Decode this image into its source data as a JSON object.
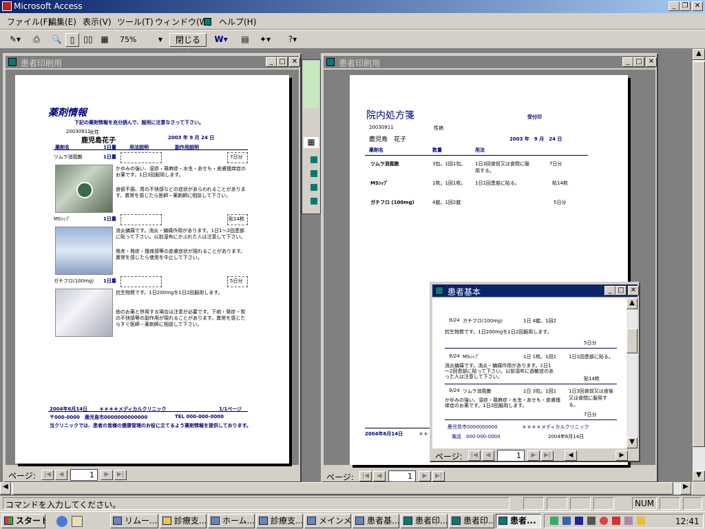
{
  "app": {
    "title": "Microsoft Access"
  },
  "menu": [
    "ファイル(F)",
    "編集(E)",
    "表示(V)",
    "ツール(T)",
    "ウィンドウ(W)",
    "ヘルプ(H)"
  ],
  "toolbar": {
    "zoom": "75%",
    "close_label": "閉じる(C)"
  },
  "win1": {
    "title": "患者印刷用",
    "page_label": "ページ:",
    "page_value": "1",
    "doc": {
      "title": "薬剤情報",
      "subtitle": "下記の薬剤情報を充分読んで、服用に注意なさって下さい。",
      "patient_id": "20030911",
      "sex": "女性",
      "patient_name": "鹿児島花子",
      "date": "2003 年 9 月 24 日",
      "headers": [
        "薬剤名",
        "1日量",
        "用法説明",
        "副作用説明"
      ],
      "drug1": "ツムラ消風散",
      "drug2": "MSｼｯﾌﾟ",
      "drug3": "ガチフロ(100mg)",
      "dose": "1日量",
      "days1": "7日分",
      "days2": "貼14枚",
      "days3": "5日分",
      "effect1": "かゆみの強い、湿疹・蕁麻疹・水虫・あせも・皮膚掻痒症のお薬です。1日3回服用します。",
      "side1": "食欲不振、胃の不快感などの症状があらわれることがあります。異常を感じたら医師・薬剤師に相談して下さい。",
      "effect2": "消炎鎮痛です。消炎・鎮痛作用があります。1日1～2回患部に貼って下さい。以前湿布にかぶれた人は注意して下さい。",
      "side2": "発赤・発疹・掻痒感等の皮膚症状が現れることがあります。異常を感じたら使用を中止して下さい。",
      "effect3": "抗生物質です。1日200mgを1日2回服用します。",
      "side3": "他のお薬と併用する場合は注意が必要です。下痢・発疹・胃の不快感等の副作用が現れることがあります。異常を感じたらすぐ医師・薬剤師に相談して下さい。",
      "footer_date": "2004年6月14日",
      "clinic": "＊＊＊＊メディカルクリニック",
      "pageno": "1/1ページ",
      "address": "〒000-0000　鹿児島市0000000000000",
      "tel": "TEL 000-000-0000",
      "note": "当クリニックでは、患者の皆様の健康管理のお役に立てるよう薬剤情報を提供しております。"
    }
  },
  "win2": {
    "title": "患者印刷用",
    "page_label": "ページ:",
    "page_value": "1",
    "doc": {
      "title": "院内処方箋",
      "stamp": "受付印",
      "patient_id": "20030911",
      "sex": "性病",
      "patient_name": "鹿児島　花子",
      "date": "2003 年　9 月　24 日",
      "headers": [
        "薬剤名",
        "数量",
        "用法"
      ],
      "rows": [
        {
          "name": "ツムラ消風散",
          "qty": "3包。1回1包。",
          "usage": "1日3回食前又は食間に服用する。",
          "days": "7日分"
        },
        {
          "name": "MSｼｯﾌﾟ",
          "qty": "1枚。1回1枚。",
          "usage": "1日1回患部に貼る。",
          "days": "貼14枚"
        },
        {
          "name": "ガチフロ (100mg)",
          "qty": "4錠。1回2錠",
          "usage": "",
          "days": "5日分"
        }
      ],
      "footer_date": "2004年6月14日",
      "footer_mark": "＊＊"
    }
  },
  "win3": {
    "title": "患者基本",
    "page_label": "ページ:",
    "page_value": "1",
    "entries": [
      {
        "date": "9/24",
        "drug": "ガチフロ(100mg)",
        "dose": "1日 4錠。1回2",
        "desc": "抗生物質です。1日200mgを1日2回服用します。",
        "days": "5日分"
      },
      {
        "date": "9/24",
        "drug": "MSｼｯﾌﾟ",
        "dose": "1日 1枚。1回1",
        "usage": "1日1回患部に貼る。",
        "desc": "消炎鎮痛です。消炎・鎮痛作用があります。1日1～2回患部に貼って下さい。以前湿布に過敏症のあった人は注意して下さい。",
        "days": "貼14枚"
      },
      {
        "date": "9/24",
        "drug": "ツムラ消風散",
        "dose": "1日 3包。1回1",
        "usage": "1日3回食前又は食後又は食間に服用する。",
        "desc": "かゆみの強い、湿疹・蕁麻疹・水虫・あせも・皮膚掻痒症のお薬です。1日3回服用します。",
        "days": "7日分"
      }
    ],
    "footer_address": "鹿児島市0000000000",
    "footer_clinic": "＊＊＊＊メディカルクリニック",
    "footer_tel": "電話　000-000-0000",
    "footer_date": "2004年6月14日"
  },
  "status": {
    "text": "コマンドを入力してください。",
    "num": "NUM"
  },
  "taskbar": {
    "start": "スタート",
    "tasks": [
      "リムー...",
      "診療支...",
      "ホーム...",
      "診療支...",
      "メインメ...",
      "患者基...",
      "患者印...",
      "患者印...",
      "患者..."
    ],
    "clock": "12:41"
  }
}
